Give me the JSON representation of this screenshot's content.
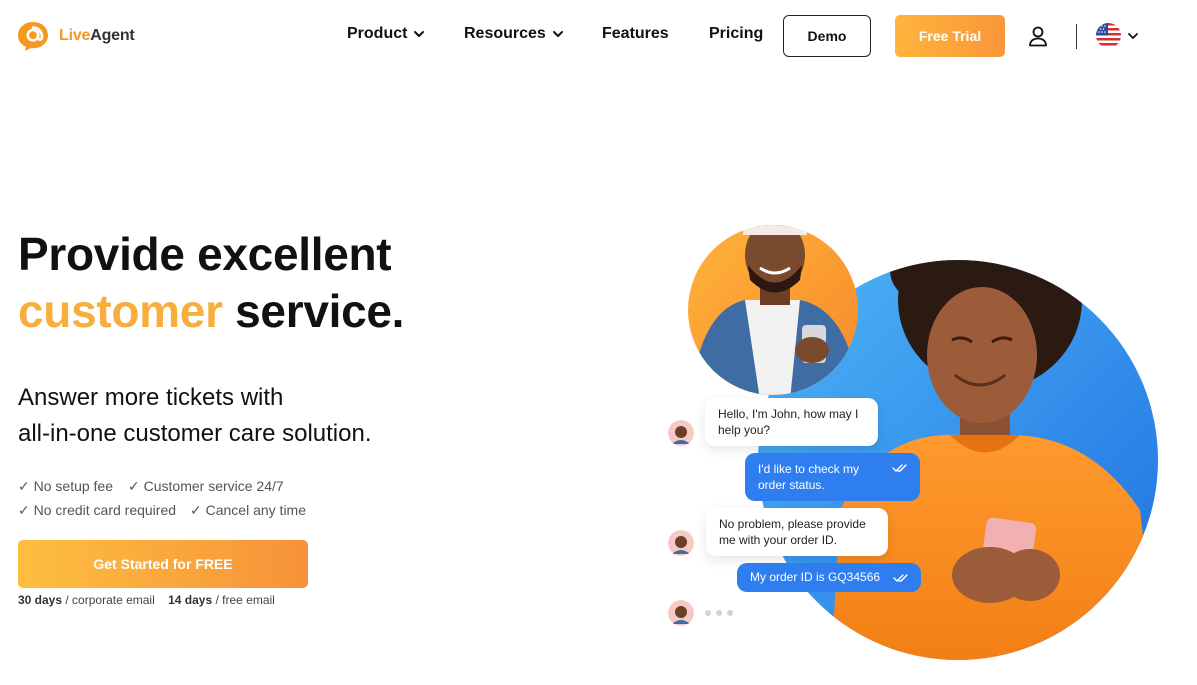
{
  "brand": {
    "name_part1": "Live",
    "name_part2": "Agent",
    "accent_color": "#f8ae3e",
    "logo_icon": "at-sign-chat-bubble-icon"
  },
  "nav": {
    "items": [
      {
        "label": "Product",
        "has_dropdown": true
      },
      {
        "label": "Resources",
        "has_dropdown": true
      },
      {
        "label": "Features",
        "has_dropdown": false
      },
      {
        "label": "Pricing",
        "has_dropdown": false
      }
    ],
    "demo_label": "Demo",
    "trial_label": "Free Trial",
    "user_icon": "user-icon",
    "language_icon": "us-flag-icon"
  },
  "hero": {
    "title_line1": "Provide excellent",
    "title_accent": "customer",
    "title_rest": " service.",
    "subtitle_line1": "Answer more tickets with",
    "subtitle_line2": "all-in-one customer care solution.",
    "checks": [
      "✓ No setup fee",
      "✓ Customer service 24/7",
      "✓ No credit card required",
      "✓ Cancel any time"
    ],
    "cta_label": "Get Started for FREE",
    "note_days1": "30 days",
    "note_text1": " / corporate email",
    "note_days2": "14 days",
    "note_text2": " / free email"
  },
  "chat": {
    "messages": [
      {
        "from": "agent",
        "text_line1": "Hello, I'm John, how may I",
        "text_line2": "help you?"
      },
      {
        "from": "customer",
        "text_line1": "I'd like to check my",
        "text_line2": "order status."
      },
      {
        "from": "agent",
        "text_line1": "No problem, please provide",
        "text_line2": "me with your order ID."
      },
      {
        "from": "customer",
        "text_line1": "My order ID is GQ34566",
        "text_line2": ""
      }
    ]
  },
  "colors": {
    "orange": "#f8ae3e",
    "blue_circle": "#2d8fe8",
    "chat_blue": "#2e7ef0"
  }
}
